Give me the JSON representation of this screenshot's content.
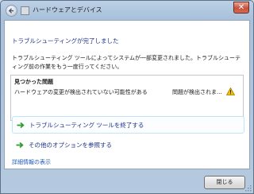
{
  "window": {
    "title": "ハードウェアとデバイス",
    "close_glyph": "✕"
  },
  "main": {
    "heading": "トラブルシューティングが完了しました",
    "description": "トラブルシューティング ツールによってシステムが一部変更されました。トラブルシューティング前の作業をもう一度行ってください。",
    "problems": {
      "header": "見つかった問題",
      "items": [
        {
          "description": "ハードウェアの変更が検出されていない可能性がある",
          "status": "問題が検出されま...",
          "icon": "warning-icon"
        }
      ]
    },
    "commands": {
      "close_tool": "トラブルシューティング ツールを終了する",
      "other_options": "その他のオプションを参照する"
    },
    "detail_link": "詳細情報の表示"
  },
  "footer": {
    "close_label": "閉じる"
  },
  "colors": {
    "heading": "#1e3287",
    "link": "#1e5bb8",
    "arrow": "#2e9b2e",
    "warning": "#f2c200"
  }
}
